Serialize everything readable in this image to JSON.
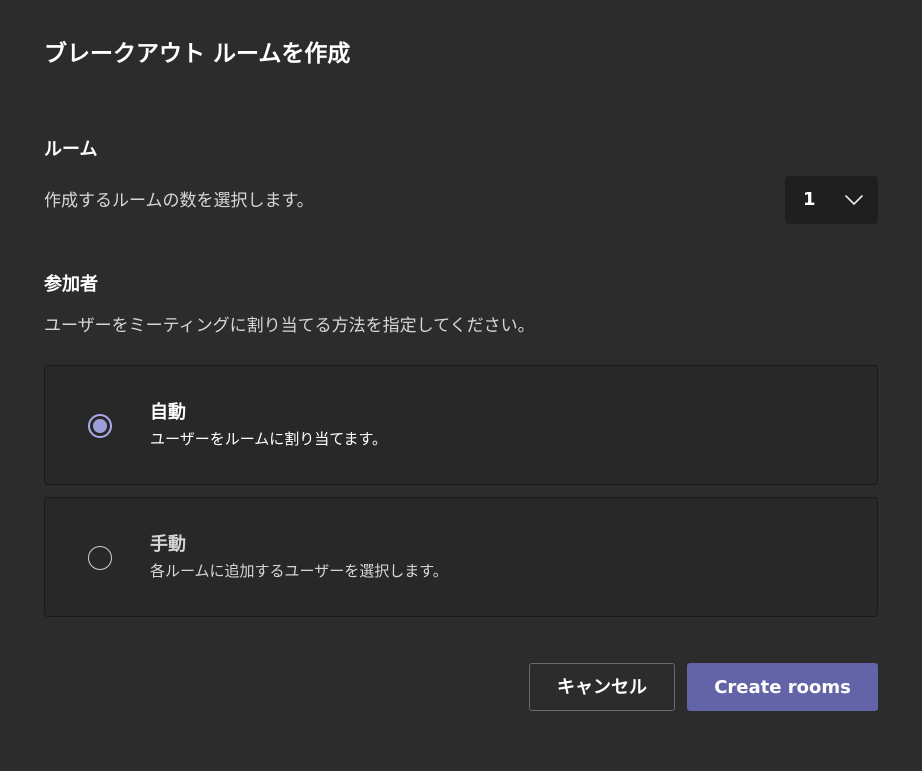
{
  "dialog": {
    "title": "ブレークアウト ルームを作成"
  },
  "rooms": {
    "heading": "ルーム",
    "description": "作成するルームの数を選択します。",
    "count_value": "1"
  },
  "participants": {
    "heading": "参加者",
    "description": "ユーザーをミーティングに割り当てる方法を指定してください。",
    "options": [
      {
        "title": "自動",
        "description": "ユーザーをルームに割り当てます。",
        "selected": true
      },
      {
        "title": "手動",
        "description": "各ルームに追加するユーザーを選択します。",
        "selected": false
      }
    ]
  },
  "footer": {
    "cancel_label": "キャンセル",
    "create_label": "Create rooms"
  },
  "colors": {
    "background": "#2d2c2c",
    "accent": "#6264a7",
    "radio_selected": "#9d9dd9"
  },
  "icons": {
    "dropdown": "chevron-down-icon"
  }
}
